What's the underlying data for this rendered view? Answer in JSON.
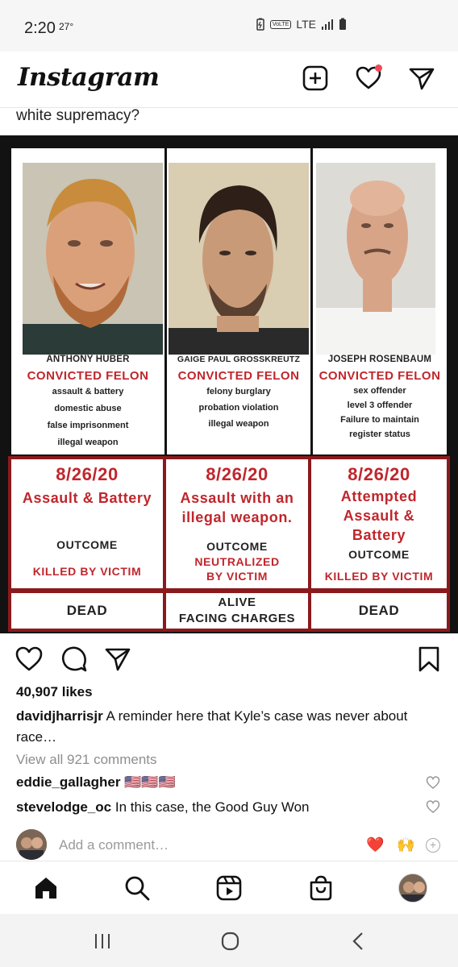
{
  "status_bar": {
    "time": "2:20",
    "temperature": "27°",
    "network": "LTE",
    "volte": "VoLTE"
  },
  "header": {
    "app_name": "Instagram",
    "icons": [
      "new-post-icon",
      "activity-heart-icon",
      "direct-message-icon"
    ],
    "notification_dot_color": "#ed4956"
  },
  "caption_top": "white supremacy?",
  "post_image": {
    "people": [
      {
        "name": "ANTHONY HUBER",
        "status": "CONVICTED FELON",
        "crimes": [
          "assault & battery",
          "domestic abuse",
          "false imprisonment",
          "illegal weapon"
        ],
        "date": "8/26/20",
        "incident": [
          "Assault & Battery"
        ],
        "outcome_label": "OUTCOME",
        "outcome": [
          "KILLED BY VICTIM"
        ],
        "final": [
          "DEAD"
        ]
      },
      {
        "name": "GAIGE PAUL GROSSKREUTZ",
        "status": "CONVICTED FELON",
        "crimes": [
          "felony burglary",
          "probation violation",
          "illegal weapon"
        ],
        "date": "8/26/20",
        "incident": [
          "Assault with  an",
          "illegal weapon."
        ],
        "outcome_label": "OUTCOME",
        "outcome": [
          "NEUTRALIZED",
          "BY VICTIM"
        ],
        "final": [
          "ALIVE",
          "FACING CHARGES"
        ]
      },
      {
        "name": "JOSEPH ROSENBAUM",
        "status": "CONVICTED FELON",
        "crimes": [
          "sex offender",
          "level 3 offender",
          "Failure to maintain",
          "register  status"
        ],
        "date": "8/26/20",
        "incident": [
          "Attempted",
          "Assault &",
          "Battery"
        ],
        "outcome_label": "OUTCOME",
        "outcome": [
          "KILLED BY VICTIM"
        ],
        "final": [
          "DEAD"
        ]
      }
    ],
    "accent_red": "#c0262c"
  },
  "actions": {
    "icons": [
      "like-heart-icon",
      "comment-icon",
      "share-icon",
      "save-bookmark-icon"
    ]
  },
  "likes": "40,907 likes",
  "caption": {
    "username": "davidjharrisjr",
    "text": "A reminder here that Kyle’s case was never about race…"
  },
  "view_all_comments": "View all 921 comments",
  "comments": [
    {
      "username": "eddie_gallagher",
      "text": "🇺🇸🇺🇸🇺🇸"
    },
    {
      "username": "stevelodge_oc",
      "text": "In this case, the Good Guy Won"
    }
  ],
  "add_comment": {
    "placeholder": "Add a comment…",
    "quick_emojis": [
      "❤️",
      "🙌"
    ]
  },
  "tab_bar": {
    "icons": [
      "home-icon",
      "search-icon",
      "reels-icon",
      "shop-icon",
      "profile-avatar"
    ]
  },
  "nav_bar": {
    "icons": [
      "recent-apps-icon",
      "home-circle-icon",
      "back-icon"
    ]
  }
}
